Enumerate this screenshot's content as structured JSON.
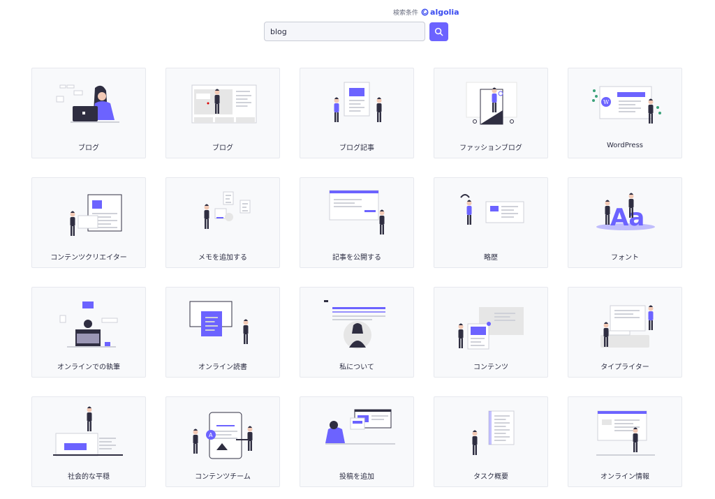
{
  "search": {
    "powered_label": "検索条件",
    "brand": "algolia",
    "value": "blog",
    "button_icon": "search-icon"
  },
  "colors": {
    "accent": "#6c63ff",
    "dark": "#2f2e41",
    "card_bg": "#f8f9fb",
    "algolia": "#3a4bf0"
  },
  "cards": [
    {
      "label": "ブログ",
      "illustration": "woman-laptop-illustration"
    },
    {
      "label": "ブログ",
      "illustration": "blog-page-illustration"
    },
    {
      "label": "ブログ記事",
      "illustration": "blog-post-illustration"
    },
    {
      "label": "ファッションブログ",
      "illustration": "fashion-blog-illustration"
    },
    {
      "label": "WordPress",
      "illustration": "wordpress-illustration"
    },
    {
      "label": "コンテンツクリエイター",
      "illustration": "content-creator-illustration"
    },
    {
      "label": "メモを追加する",
      "illustration": "add-notes-illustration"
    },
    {
      "label": "記事を公開する",
      "illustration": "publish-article-illustration"
    },
    {
      "label": "略歴",
      "illustration": "resume-illustration"
    },
    {
      "label": "フォント",
      "illustration": "font-illustration"
    },
    {
      "label": "オンラインでの執筆",
      "illustration": "online-writing-illustration"
    },
    {
      "label": "オンライン読書",
      "illustration": "online-reading-illustration"
    },
    {
      "label": "私について",
      "illustration": "about-me-illustration"
    },
    {
      "label": "コンテンツ",
      "illustration": "content-illustration"
    },
    {
      "label": "タイプライター",
      "illustration": "typewriter-illustration"
    },
    {
      "label": "社会的な平穏",
      "illustration": "social-serenity-illustration"
    },
    {
      "label": "コンテンツチーム",
      "illustration": "content-team-illustration"
    },
    {
      "label": "投稿を追加",
      "illustration": "add-post-illustration"
    },
    {
      "label": "タスク概要",
      "illustration": "task-summary-illustration"
    },
    {
      "label": "オンライン情報",
      "illustration": "online-info-illustration"
    }
  ]
}
